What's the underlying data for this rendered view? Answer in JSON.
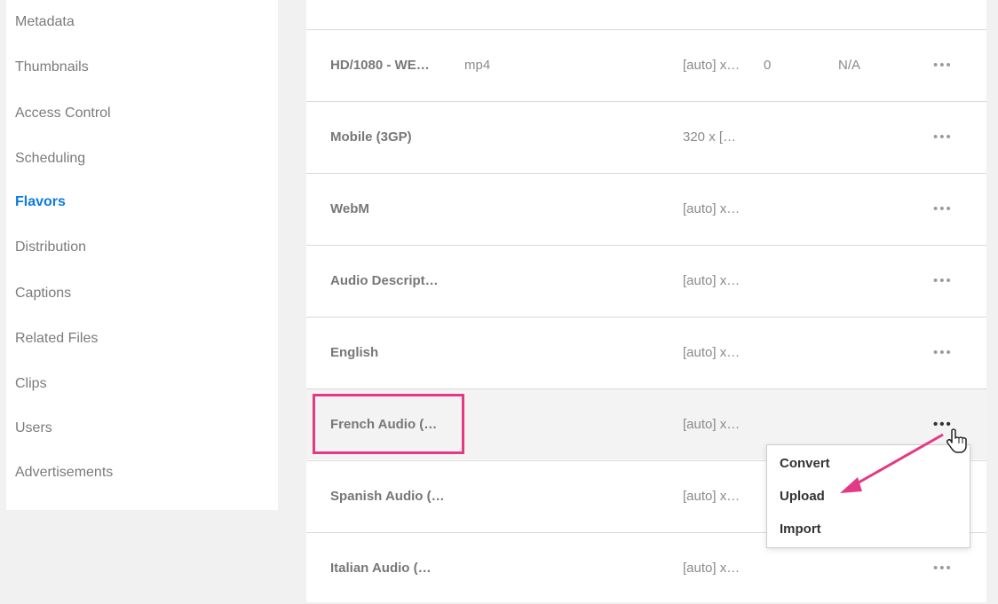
{
  "sidebar": {
    "items": [
      {
        "label": "Metadata",
        "active": false
      },
      {
        "label": "Thumbnails",
        "active": false
      },
      {
        "label": "Access Control",
        "active": false
      },
      {
        "label": "Scheduling",
        "active": false
      },
      {
        "label": "Flavors",
        "active": true
      },
      {
        "label": "Distribution",
        "active": false
      },
      {
        "label": "Captions",
        "active": false
      },
      {
        "label": "Related Files",
        "active": false
      },
      {
        "label": "Clips",
        "active": false
      },
      {
        "label": "Users",
        "active": false
      },
      {
        "label": "Advertisements",
        "active": false
      }
    ]
  },
  "flavors": {
    "rows": [
      {
        "name": "HD/1080 - WE…",
        "format": "mp4",
        "dimensions": "[auto] x…",
        "bitrate": "0",
        "size": "N/A",
        "more": "•••"
      },
      {
        "name": "Mobile (3GP)",
        "format": "",
        "dimensions": "320 x […",
        "bitrate": "",
        "size": "",
        "more": "•••"
      },
      {
        "name": "WebM",
        "format": "",
        "dimensions": "[auto] x…",
        "bitrate": "",
        "size": "",
        "more": "•••"
      },
      {
        "name": "Audio Descript…",
        "format": "",
        "dimensions": "[auto] x…",
        "bitrate": "",
        "size": "",
        "more": "•••"
      },
      {
        "name": "English",
        "format": "",
        "dimensions": "[auto] x…",
        "bitrate": "",
        "size": "",
        "more": "•••"
      },
      {
        "name": "French Audio (…",
        "format": "",
        "dimensions": "[auto] x…",
        "bitrate": "",
        "size": "",
        "more": "•••"
      },
      {
        "name": "Spanish Audio (…",
        "format": "",
        "dimensions": "[auto] x…",
        "bitrate": "",
        "size": "",
        "more": ""
      },
      {
        "name": "Italian Audio (…",
        "format": "",
        "dimensions": "[auto] x…",
        "bitrate": "",
        "size": "",
        "more": "•••"
      }
    ]
  },
  "actions_menu": {
    "items": [
      "Convert",
      "Upload",
      "Import"
    ]
  },
  "colors": {
    "accent": "#0a7be0",
    "highlight": "#e23a85"
  }
}
